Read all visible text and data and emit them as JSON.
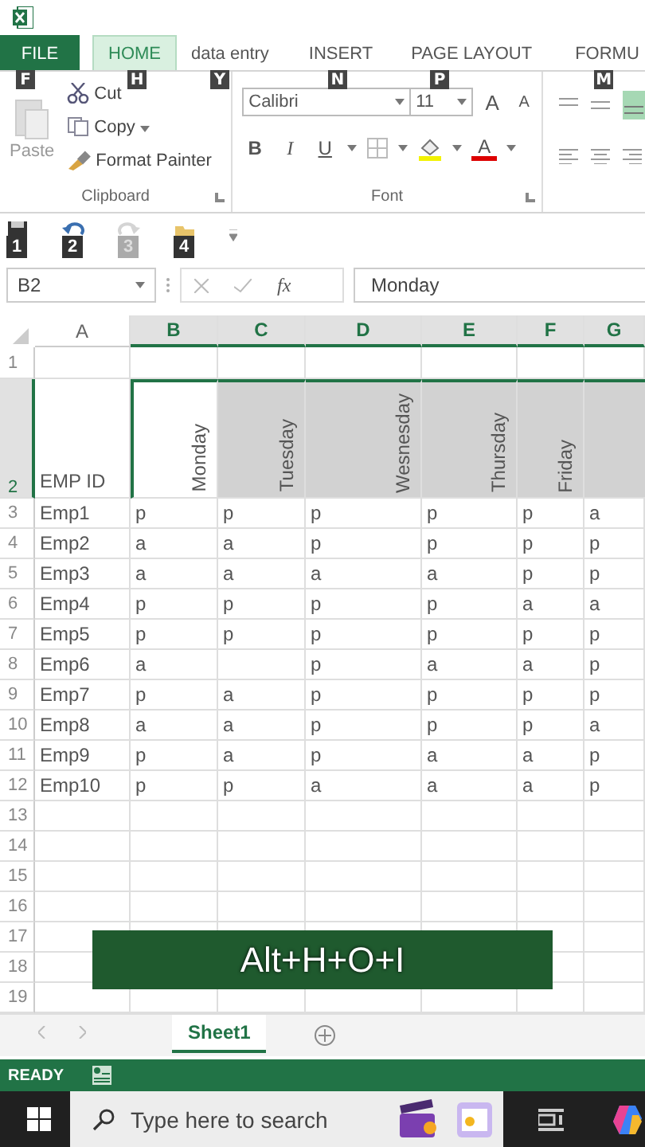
{
  "ribbon_tabs": [
    {
      "label": "FILE",
      "key_tip": "F",
      "kind": "file",
      "selected": false
    },
    {
      "label": "HOME",
      "key_tip": "H",
      "kind": "tab",
      "selected": true
    },
    {
      "label": "data entry",
      "key_tip": "Y",
      "kind": "tab",
      "selected": false
    },
    {
      "label": "INSERT",
      "key_tip": "N",
      "kind": "tab",
      "selected": false
    },
    {
      "label": "PAGE LAYOUT",
      "key_tip": "P",
      "kind": "tab",
      "selected": false
    },
    {
      "label": "FORMU",
      "key_tip": "M",
      "kind": "tab",
      "selected": false
    }
  ],
  "clipboard": {
    "paste": "Paste",
    "cut": "Cut",
    "copy": "Copy",
    "format_painter": "Format Painter",
    "group_label": "Clipboard"
  },
  "font": {
    "font_name": "Calibri",
    "font_size": "11",
    "grow": "A",
    "shrink": "A",
    "bold": "B",
    "italic": "I",
    "underline": "U",
    "font_color": "A",
    "group_label": "Font"
  },
  "quick_access": [
    {
      "kind": "save",
      "key_tip": "1",
      "disabled": false
    },
    {
      "kind": "undo",
      "key_tip": "2",
      "disabled": false
    },
    {
      "kind": "redo",
      "key_tip": "3",
      "disabled": true
    },
    {
      "kind": "open",
      "key_tip": "4",
      "disabled": false
    }
  ],
  "formula_bar": {
    "name_box": "B2",
    "function_label": "fx",
    "value": "Monday"
  },
  "sheet": {
    "columns": [
      {
        "label": "A",
        "selected": false
      },
      {
        "label": "B",
        "selected": true
      },
      {
        "label": "C",
        "selected": true
      },
      {
        "label": "D",
        "selected": true
      },
      {
        "label": "E",
        "selected": true
      },
      {
        "label": "F",
        "selected": true
      },
      {
        "label": "G",
        "selected": true
      }
    ],
    "rows": [
      {
        "number": "1",
        "kind": "plain",
        "selected": false
      },
      {
        "number": "2",
        "kind": "rotated",
        "selected": true,
        "cells": [
          {
            "text": "EMP ID",
            "selected": false,
            "active": false
          },
          {
            "text": "Monday",
            "selected": true,
            "active": true
          },
          {
            "text": "Tuesday",
            "selected": true,
            "active": false
          },
          {
            "text": "Wesnesday",
            "selected": true,
            "active": false
          },
          {
            "text": "Thursday",
            "selected": true,
            "active": false
          },
          {
            "text": "Friday",
            "selected": true,
            "active": false
          },
          {
            "selected": true,
            "active": false
          }
        ]
      },
      {
        "number": "3",
        "kind": "plain",
        "selected": false,
        "cells": [
          "Emp1",
          "p",
          "p",
          "p",
          "p",
          "p",
          "a"
        ]
      },
      {
        "number": "4",
        "kind": "plain",
        "selected": false,
        "cells": [
          "Emp2",
          "a",
          "a",
          "p",
          "p",
          "p",
          "p"
        ]
      },
      {
        "number": "5",
        "kind": "plain",
        "selected": false,
        "cells": [
          "Emp3",
          "a",
          "a",
          "a",
          "a",
          "p",
          "p"
        ]
      },
      {
        "number": "6",
        "kind": "plain",
        "selected": false,
        "cells": [
          "Emp4",
          "p",
          "p",
          "p",
          "p",
          "a",
          "a"
        ]
      },
      {
        "number": "7",
        "kind": "plain",
        "selected": false,
        "cells": [
          "Emp5",
          "p",
          "p",
          "p",
          "p",
          "p",
          "p"
        ]
      },
      {
        "number": "8",
        "kind": "plain",
        "selected": false,
        "cells": [
          "Emp6",
          "a",
          null,
          "p",
          "a",
          "a",
          "p"
        ]
      },
      {
        "number": "9",
        "kind": "plain",
        "selected": false,
        "cells": [
          "Emp7",
          "p",
          "a",
          "p",
          "p",
          "p",
          "p"
        ]
      },
      {
        "number": "10",
        "kind": "plain",
        "selected": false,
        "cells": [
          "Emp8",
          "a",
          "a",
          "p",
          "p",
          "p",
          "a"
        ]
      },
      {
        "number": "11",
        "kind": "plain",
        "selected": false,
        "cells": [
          "Emp9",
          "p",
          "a",
          "p",
          "a",
          "a",
          "p"
        ]
      },
      {
        "number": "12",
        "kind": "plain",
        "selected": false,
        "cells": [
          "Emp10",
          "p",
          "p",
          "a",
          "a",
          "a",
          "p"
        ]
      },
      {
        "number": "13",
        "kind": "plain",
        "selected": false
      },
      {
        "number": "14",
        "kind": "plain",
        "selected": false
      },
      {
        "number": "15",
        "kind": "plain",
        "selected": false
      },
      {
        "number": "16",
        "kind": "plain",
        "selected": false
      },
      {
        "number": "17",
        "kind": "plain",
        "selected": false
      },
      {
        "number": "18",
        "kind": "plain",
        "selected": false
      },
      {
        "number": "19",
        "kind": "plain",
        "selected": false
      }
    ]
  },
  "caption": "Alt+H+O+I",
  "sheet_tabs": [
    {
      "label": "Sheet1",
      "selected": true
    }
  ],
  "status_bar": {
    "status": "READY"
  },
  "taskbar": {
    "search_placeholder": "Type here to search"
  }
}
